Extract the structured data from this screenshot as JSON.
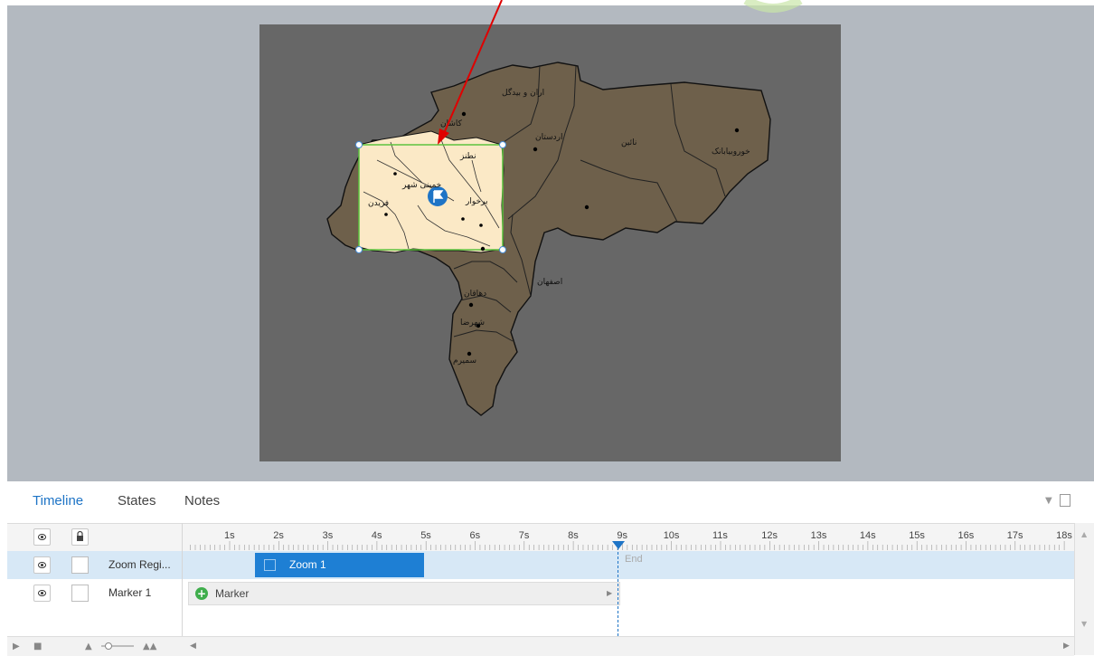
{
  "map": {
    "regions": [
      {
        "label": "اران و بیدگل"
      },
      {
        "label": "اردستان"
      },
      {
        "label": "نائین"
      },
      {
        "label": "خوروبیابانک"
      },
      {
        "label": "اصفهان"
      },
      {
        "label": "دهاقان"
      },
      {
        "label": "شهرضا"
      },
      {
        "label": "سمیرم"
      },
      {
        "label": "کاشان"
      },
      {
        "label": "نطنز"
      },
      {
        "label": "برخوار"
      },
      {
        "label": "فریدن"
      },
      {
        "label": "خمینی شهر"
      }
    ],
    "zoom_region": {
      "marker_icon": "flag-icon"
    }
  },
  "panel": {
    "tabs": [
      {
        "label": "Timeline",
        "active": true
      },
      {
        "label": "States",
        "active": false
      },
      {
        "label": "Notes",
        "active": false
      }
    ]
  },
  "timeline": {
    "ticks": [
      "1s",
      "2s",
      "3s",
      "4s",
      "5s",
      "6s",
      "7s",
      "8s",
      "9s",
      "10s",
      "11s",
      "12s",
      "13s",
      "14s",
      "15s",
      "16s",
      "17s",
      "18s"
    ],
    "tracks": [
      {
        "name": "Zoom Regi...",
        "clip_label": "Zoom 1"
      },
      {
        "name": "Marker 1",
        "clip_label": "Marker"
      }
    ],
    "end_label": "End",
    "playhead_time": "9s"
  },
  "colors": {
    "accent": "#1e74c6",
    "zoom_clip": "#1e7fd4",
    "zoom_row": "#d7e8f6",
    "map_land": "#6e604b",
    "map_highlight": "#fbe9c6",
    "arrow": "#e00000"
  }
}
